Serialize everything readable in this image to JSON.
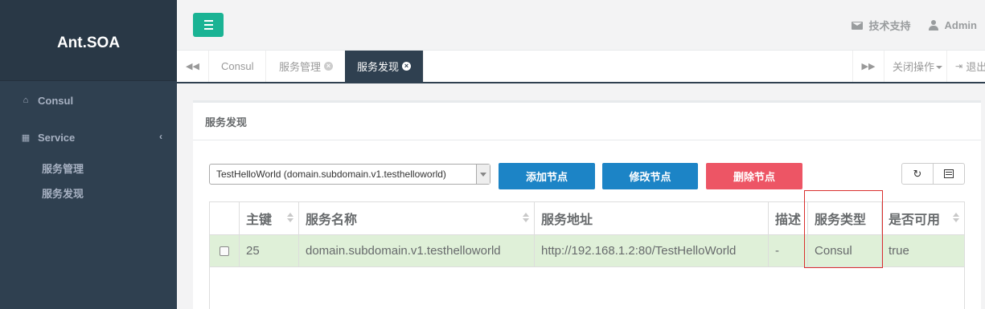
{
  "app": {
    "logo": "Ant.SOA"
  },
  "sidebar": {
    "items": [
      {
        "label": "Consul",
        "icon": "home-icon"
      },
      {
        "label": "Service",
        "icon": "table-icon",
        "caret": "‹"
      }
    ],
    "subitems": [
      {
        "label": "服务管理"
      },
      {
        "label": "服务发现"
      }
    ]
  },
  "header": {
    "support": "技术支持",
    "user": "Admin"
  },
  "tabs": {
    "items": [
      {
        "label": "Consul"
      },
      {
        "label": "服务管理",
        "close": "×"
      },
      {
        "label": "服务发现",
        "close": "×"
      }
    ],
    "close_ops": "关闭操作",
    "logout": "退出"
  },
  "panel": {
    "title": "服务发现",
    "select_value": "TestHelloWorld (domain.subdomain.v1.testhelloworld)",
    "buttons": {
      "add": "添加节点",
      "edit": "修改节点",
      "delete": "删除节点"
    },
    "refresh_glyph": "↻"
  },
  "table": {
    "headers": [
      "主键",
      "服务名称",
      "服务地址",
      "描述",
      "服务类型",
      "是否可用"
    ],
    "rows": [
      [
        "25",
        "domain.subdomain.v1.testhelloworld",
        "http://192.168.1.2:80/TestHelloWorld",
        "-",
        "Consul",
        "true"
      ]
    ]
  },
  "colors": {
    "sidebar": "#2f4050",
    "primary": "#1c84c6",
    "danger": "#ed5565",
    "menu_button": "#1ab394",
    "row_selected": "#dff0d8",
    "highlight": "#d9302f"
  }
}
